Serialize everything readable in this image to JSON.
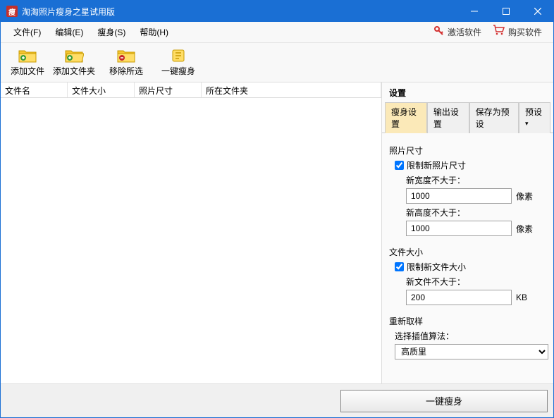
{
  "window": {
    "title": "淘淘照片瘦身之星试用版"
  },
  "menu": {
    "file": "文件(F)",
    "edit": "编辑(E)",
    "slim": "瘦身(S)",
    "help": "帮助(H)",
    "activate": "激活软件",
    "buy": "购买软件"
  },
  "toolbar": {
    "addFile": "添加文件",
    "addFolder": "添加文件夹",
    "removeSelected": "移除所选",
    "oneKeySlim": "一键瘦身"
  },
  "table": {
    "headers": {
      "name": "文件名",
      "size": "文件大小",
      "dim": "照片尺寸",
      "folder": "所在文件夹"
    }
  },
  "settings": {
    "title": "设置",
    "tabs": {
      "slim": "瘦身设置",
      "output": "输出设置",
      "savePreset": "保存为预设",
      "preset": "预设"
    },
    "photoSize": {
      "label": "照片尺寸",
      "limitLabel": "限制新照片尺寸",
      "limitChecked": true,
      "widthLabel": "新宽度不大于：",
      "widthValue": "1000",
      "heightLabel": "新高度不大于：",
      "heightValue": "1000",
      "unit": "像素"
    },
    "fileSize": {
      "label": "文件大小",
      "limitLabel": "限制新文件大小",
      "limitChecked": true,
      "sizeLabel": "新文件不大于：",
      "sizeValue": "200",
      "unit": "KB"
    },
    "resample": {
      "label": "重新取样",
      "algoLabel": "选择插值算法：",
      "algoValue": "高质里"
    }
  },
  "footer": {
    "action": "一键瘦身"
  }
}
